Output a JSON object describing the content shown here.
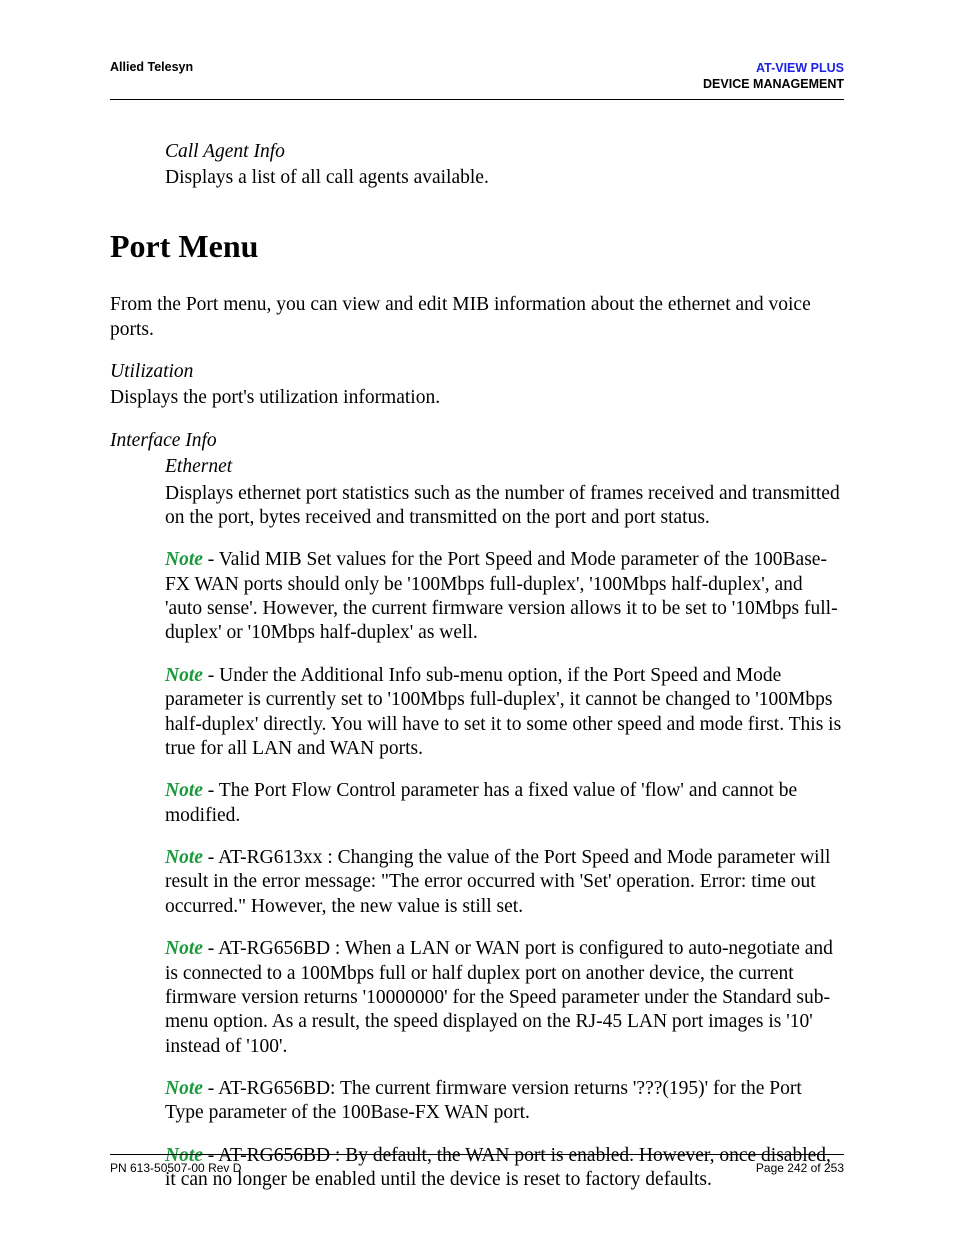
{
  "header": {
    "left": "Allied Telesyn",
    "right1": "AT-VIEW PLUS",
    "right2": "DEVICE MANAGEMENT"
  },
  "intro": {
    "call_agent_title": "Call Agent Info",
    "call_agent_desc": "Displays a list of all call agents available."
  },
  "section_title": "Port Menu",
  "section_intro": "From the Port menu, you can view and edit MIB information about the ethernet and voice ports.",
  "utilization": {
    "title": "Utilization",
    "desc": "Displays the port's utilization information."
  },
  "interface": {
    "title": "Interface Info",
    "eth_title": "Ethernet",
    "eth_desc": "Displays ethernet port statistics such as the number of frames received and transmitted on the port, bytes received and transmitted on the port and port status."
  },
  "note_label": "Note",
  "notes": {
    "n1": " - Valid MIB Set values for the Port Speed and Mode parameter of the 100Base-FX WAN ports should only be '100Mbps full-duplex', '100Mbps half-duplex', and 'auto sense'. However, the current firmware version allows it to be set to '10Mbps full-duplex' or '10Mbps half-duplex' as well.",
    "n2": " - Under the Additional Info sub-menu option, if the Port Speed and Mode parameter is currently set to '100Mbps full-duplex', it cannot be changed to '100Mbps half-duplex' directly. You will have to set it to some other speed and mode first. This is true for all LAN and WAN ports.",
    "n3": " - The Port Flow Control parameter has a fixed value of 'flow' and cannot be modified.",
    "n4": " - AT-RG613xx : Changing the value of the Port Speed and Mode parameter will result in the error message: \"The error occurred with 'Set' operation. Error: time out occurred.\" However, the new value is still set.",
    "n5": " - AT-RG656BD : When a LAN or WAN port is configured to auto-negotiate and is connected to a 100Mbps full or half duplex port on another device, the current firmware version returns '10000000' for the Speed parameter under the Standard sub-menu option. As a result, the speed displayed on the RJ-45 LAN port images is '10' instead of '100'.",
    "n6": " - AT-RG656BD: The current firmware version returns '???(195)' for the Port Type parameter of the 100Base-FX WAN port.",
    "n7": " - AT-RG656BD : By default, the WAN port is enabled. However, once disabled, it can no longer be enabled until the device is reset to factory defaults."
  },
  "footer": {
    "left": "PN 613-50507-00 Rev D",
    "right": "Page 242 of 253"
  }
}
